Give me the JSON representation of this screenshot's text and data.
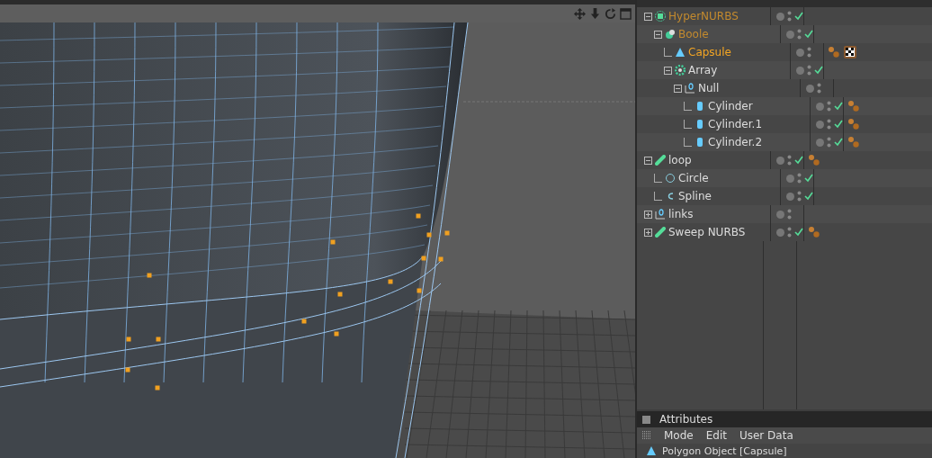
{
  "objects": [
    {
      "name": "HyperNURBS",
      "kind": "hypernurbs",
      "highlighted": true,
      "selected": false,
      "expanded": true,
      "enabled": true,
      "phong_tag": false,
      "texture_tag": false,
      "children": [
        {
          "name": "Boole",
          "kind": "boole",
          "highlighted": true,
          "selected": false,
          "expanded": true,
          "enabled": true,
          "phong_tag": false,
          "texture_tag": false,
          "children": [
            {
              "name": "Capsule",
              "kind": "capsule",
              "highlighted": false,
              "selected": true,
              "enabled": false,
              "phong_tag": true,
              "texture_tag": true
            },
            {
              "name": "Array",
              "kind": "array",
              "highlighted": false,
              "selected": false,
              "expanded": true,
              "enabled": true,
              "phong_tag": false,
              "texture_tag": false,
              "children": [
                {
                  "name": "Null",
                  "kind": "null",
                  "highlighted": false,
                  "selected": false,
                  "expanded": true,
                  "enabled": false,
                  "phong_tag": false,
                  "texture_tag": false,
                  "children": [
                    {
                      "name": "Cylinder",
                      "kind": "cylinder",
                      "highlighted": false,
                      "selected": false,
                      "enabled": true,
                      "phong_tag": true,
                      "texture_tag": false
                    },
                    {
                      "name": "Cylinder.1",
                      "kind": "cylinder",
                      "highlighted": false,
                      "selected": false,
                      "enabled": true,
                      "phong_tag": true,
                      "texture_tag": false
                    },
                    {
                      "name": "Cylinder.2",
                      "kind": "cylinder",
                      "highlighted": false,
                      "selected": false,
                      "enabled": true,
                      "phong_tag": true,
                      "texture_tag": false
                    }
                  ]
                }
              ]
            }
          ]
        }
      ]
    },
    {
      "name": "loop",
      "kind": "sweep",
      "highlighted": false,
      "selected": false,
      "expanded": true,
      "enabled": true,
      "phong_tag": true,
      "texture_tag": false,
      "children": [
        {
          "name": "Circle",
          "kind": "circle",
          "highlighted": false,
          "selected": false,
          "enabled": true,
          "phong_tag": false,
          "texture_tag": false
        },
        {
          "name": "Spline",
          "kind": "spline",
          "highlighted": false,
          "selected": false,
          "enabled": true,
          "phong_tag": false,
          "texture_tag": false
        }
      ]
    },
    {
      "name": "links",
      "kind": "null",
      "highlighted": false,
      "selected": false,
      "expanded": false,
      "enabled": false,
      "phong_tag": false,
      "texture_tag": false
    },
    {
      "name": "Sweep NURBS",
      "kind": "sweep",
      "highlighted": false,
      "selected": false,
      "expanded": false,
      "enabled": true,
      "phong_tag": true,
      "texture_tag": false
    }
  ],
  "attributes": {
    "title": "Attributes",
    "menu": [
      "Mode",
      "Edit",
      "User Data"
    ],
    "object_title": "Polygon Object [Capsule]"
  }
}
